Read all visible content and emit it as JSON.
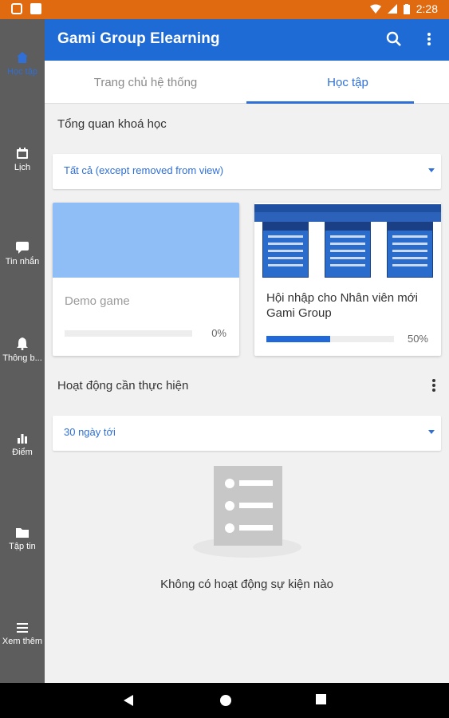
{
  "status_bar": {
    "time": "2:28"
  },
  "app_bar": {
    "title": "Gami Group Elearning"
  },
  "rail": {
    "items": [
      {
        "label": "Học tập",
        "icon": "home-icon",
        "active": true
      },
      {
        "label": "Lịch",
        "icon": "calendar-icon",
        "active": false
      },
      {
        "label": "Tin nhắn",
        "icon": "chat-icon",
        "active": false
      },
      {
        "label": "Thông b...",
        "icon": "bell-icon",
        "active": false
      },
      {
        "label": "Điểm",
        "icon": "bar-chart-icon",
        "active": false
      },
      {
        "label": "Tập tin",
        "icon": "folder-icon",
        "active": false
      },
      {
        "label": "Xem thêm",
        "icon": "menu-icon",
        "active": false
      }
    ]
  },
  "tabs": [
    {
      "label": "Trang chủ hệ thống",
      "active": false
    },
    {
      "label": "Học tập",
      "active": true
    }
  ],
  "courses_section": {
    "title": "Tổng quan khoá học",
    "filter_value": "Tất cả (except removed from view)",
    "courses": [
      {
        "name": "Demo game",
        "progress_percent": 0,
        "progress_label": "0%"
      },
      {
        "name": "Hội nhập cho Nhân viên mới Gami Group",
        "progress_percent": 50,
        "progress_label": "50%"
      }
    ]
  },
  "activities_section": {
    "title": "Hoạt động cần thực hiện",
    "filter_value": "30 ngày tới",
    "empty_message": "Không có hoạt động sự kiện nào"
  },
  "colors": {
    "status_bar": "#e06a10",
    "app_bar": "#1f6bd6",
    "accent": "#2f6fd6",
    "rail": "#5d5d5d"
  }
}
